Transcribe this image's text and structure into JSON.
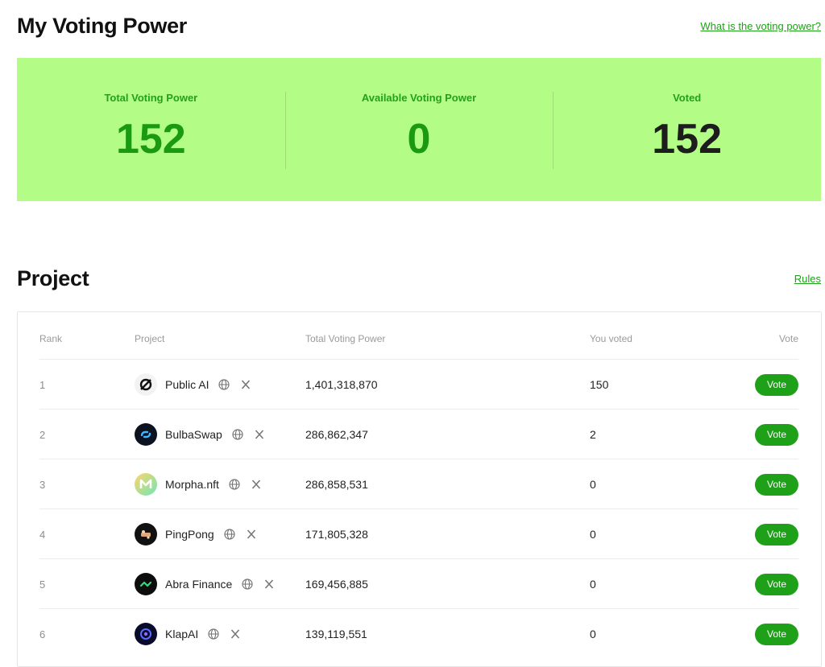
{
  "voting": {
    "title": "My Voting Power",
    "help_link": "What is the voting power?",
    "stats": [
      {
        "label": "Total Voting Power",
        "value": "152"
      },
      {
        "label": "Available Voting Power",
        "value": "0"
      },
      {
        "label": "Voted",
        "value": "152"
      }
    ]
  },
  "projects": {
    "title": "Project",
    "rules_link": "Rules",
    "columns": {
      "rank": "Rank",
      "project": "Project",
      "total": "Total Voting Power",
      "you": "You voted",
      "vote": "Vote"
    },
    "vote_label": "Vote",
    "rows": [
      {
        "rank": "1",
        "name": "Public AI",
        "total": "1,401,318,870",
        "you": "150",
        "logo": "public-ai-logo"
      },
      {
        "rank": "2",
        "name": "BulbaSwap",
        "total": "286,862,347",
        "you": "2",
        "logo": "bulbaswap-logo"
      },
      {
        "rank": "3",
        "name": "Morpha.nft",
        "total": "286,858,531",
        "you": "0",
        "logo": "morpha-logo"
      },
      {
        "rank": "4",
        "name": "PingPong",
        "total": "171,805,328",
        "you": "0",
        "logo": "pingpong-logo"
      },
      {
        "rank": "5",
        "name": "Abra Finance",
        "total": "169,456,885",
        "you": "0",
        "logo": "abra-finance-logo"
      },
      {
        "rank": "6",
        "name": "KlapAI",
        "total": "139,119,551",
        "you": "0",
        "logo": "klapai-logo"
      }
    ]
  },
  "colors": {
    "accent": "#1ea118",
    "panel": "#b3fd86"
  }
}
